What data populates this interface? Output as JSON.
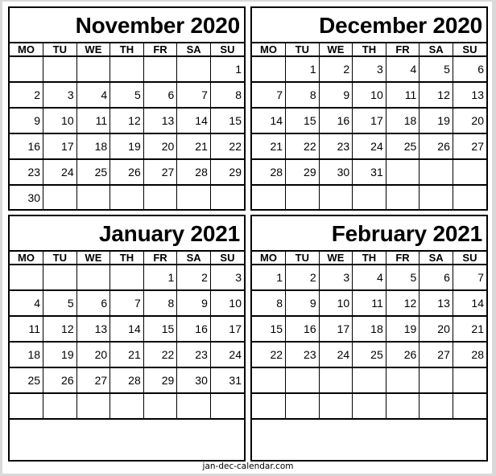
{
  "weekdays": [
    "MO",
    "TU",
    "WE",
    "TH",
    "FR",
    "SA",
    "SU"
  ],
  "calendars": [
    {
      "title": "November 2020",
      "weeks": [
        [
          "",
          "",
          "",
          "",
          "",
          "",
          "1"
        ],
        [
          "2",
          "3",
          "4",
          "5",
          "6",
          "7",
          "8"
        ],
        [
          "9",
          "10",
          "11",
          "12",
          "13",
          "14",
          "15"
        ],
        [
          "16",
          "17",
          "18",
          "19",
          "20",
          "21",
          "22"
        ],
        [
          "23",
          "24",
          "25",
          "26",
          "27",
          "28",
          "29"
        ],
        [
          "30",
          "",
          "",
          "",
          "",
          "",
          ""
        ]
      ]
    },
    {
      "title": "December 2020",
      "weeks": [
        [
          "",
          "1",
          "2",
          "3",
          "4",
          "5",
          "6"
        ],
        [
          "7",
          "8",
          "9",
          "10",
          "11",
          "12",
          "13"
        ],
        [
          "14",
          "15",
          "16",
          "17",
          "18",
          "19",
          "20"
        ],
        [
          "21",
          "22",
          "23",
          "24",
          "25",
          "26",
          "27"
        ],
        [
          "28",
          "29",
          "30",
          "31",
          "",
          "",
          ""
        ],
        [
          "",
          "",
          "",
          "",
          "",
          "",
          ""
        ]
      ]
    },
    {
      "title": "January 2021",
      "weeks": [
        [
          "",
          "",
          "",
          "",
          "1",
          "2",
          "3"
        ],
        [
          "4",
          "5",
          "6",
          "7",
          "8",
          "9",
          "10"
        ],
        [
          "11",
          "12",
          "13",
          "14",
          "15",
          "16",
          "17"
        ],
        [
          "18",
          "19",
          "20",
          "21",
          "22",
          "23",
          "24"
        ],
        [
          "25",
          "26",
          "27",
          "28",
          "29",
          "30",
          "31"
        ],
        [
          "",
          "",
          "",
          "",
          "",
          "",
          ""
        ]
      ]
    },
    {
      "title": "February 2021",
      "weeks": [
        [
          "1",
          "2",
          "3",
          "4",
          "5",
          "6",
          "7"
        ],
        [
          "8",
          "9",
          "10",
          "11",
          "12",
          "13",
          "14"
        ],
        [
          "15",
          "16",
          "17",
          "18",
          "19",
          "20",
          "21"
        ],
        [
          "22",
          "23",
          "24",
          "25",
          "26",
          "27",
          "28"
        ],
        [
          "",
          "",
          "",
          "",
          "",
          "",
          ""
        ],
        [
          "",
          "",
          "",
          "",
          "",
          "",
          ""
        ]
      ]
    }
  ],
  "footer": "jan-dec-calendar.com",
  "colors": {
    "frame": "#d9d9d9",
    "lines": "#000000",
    "background": "#ffffff"
  }
}
